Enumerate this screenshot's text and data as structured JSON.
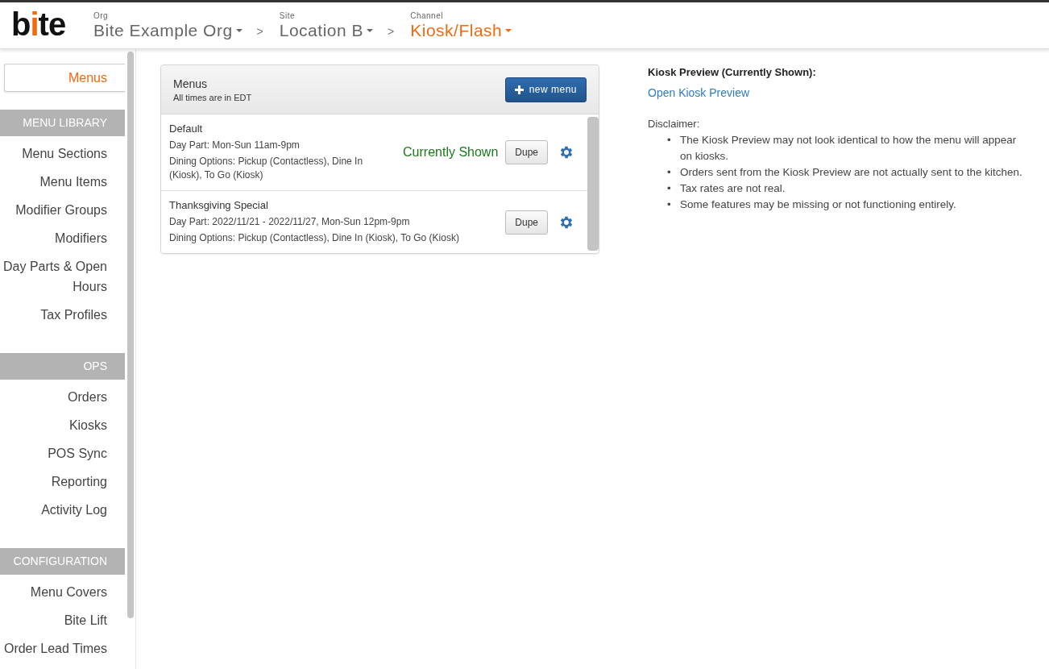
{
  "header": {
    "logo": "bite",
    "breadcrumbs": [
      {
        "caption": "Org",
        "value": "Bite Example Org",
        "current": false
      },
      {
        "caption": "Site",
        "value": "Location B",
        "current": false
      },
      {
        "caption": "Channel",
        "value": "Kiosk/Flash",
        "current": true
      }
    ],
    "separator": ">"
  },
  "sidebar": {
    "top_item": {
      "label": "Menus",
      "selected": true
    },
    "sections": [
      {
        "title": "MENU LIBRARY",
        "items": [
          {
            "label": "Menu Sections",
            "selected": false
          },
          {
            "label": "Menu Items",
            "selected": false
          },
          {
            "label": "Modifier Groups",
            "selected": false
          },
          {
            "label": "Modifiers",
            "selected": false
          },
          {
            "label": "Day Parts & Open Hours",
            "selected": false
          },
          {
            "label": "Tax Profiles",
            "selected": false
          }
        ]
      },
      {
        "title": "OPS",
        "items": [
          {
            "label": "Orders",
            "selected": false
          },
          {
            "label": "Kiosks",
            "selected": false
          },
          {
            "label": "POS Sync",
            "selected": false
          },
          {
            "label": "Reporting",
            "selected": false
          },
          {
            "label": "Activity Log",
            "selected": false
          }
        ]
      },
      {
        "title": "CONFIGURATION",
        "items": [
          {
            "label": "Menu Covers",
            "selected": false
          },
          {
            "label": "Bite Lift",
            "selected": false
          },
          {
            "label": "Order Lead Times",
            "selected": false
          }
        ]
      }
    ]
  },
  "menus_panel": {
    "title": "Menus",
    "subtitle": "All times are in EDT",
    "new_button": "new menu",
    "menus": [
      {
        "name": "Default",
        "day_part": "Day Part: Mon-Sun 11am-9pm",
        "dining_options": "Dining Options: Pickup (Contactless), Dine In (Kiosk), To Go (Kiosk)",
        "status": "Currently Shown",
        "dupe": "Dupe"
      },
      {
        "name": "Thanksgiving Special",
        "day_part": "Day Part: 2022/11/21 - 2022/11/27, Mon-Sun 12pm-9pm",
        "dining_options": "Dining Options: Pickup (Contactless), Dine In (Kiosk), To Go (Kiosk)",
        "dupe": "Dupe"
      }
    ]
  },
  "preview": {
    "title": "Kiosk Preview (Currently Shown):",
    "link": "Open Kiosk Preview",
    "disclaimer_title": "Disclaimer:",
    "bullet": "•",
    "disclaimers": [
      "The Kiosk Preview may not look identical to how the menu will appear on kiosks.",
      "Orders sent from the Kiosk Preview are not actually sent to the kitchen.",
      "Tax rates are not real.",
      "Some features may be missing or not functioning entirely."
    ]
  }
}
